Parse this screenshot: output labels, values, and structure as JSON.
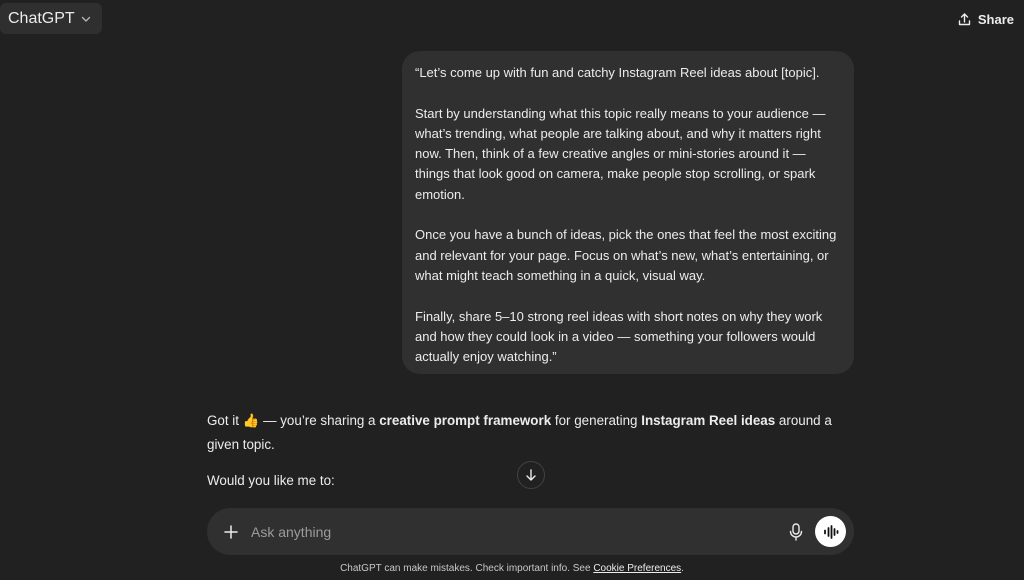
{
  "header": {
    "model_label": "ChatGPT",
    "share_label": "Share",
    "icons": {
      "model_dropdown": "chevron-down-icon",
      "share": "share-icon"
    }
  },
  "conversation": {
    "user_message": {
      "paragraphs": [
        "“Let’s come up with fun and catchy Instagram Reel ideas about [topic].",
        "Start by understanding what this topic really means to your audience — what’s trending, what people are talking about, and why it matters right now. Then, think of a few creative angles or mini-stories around it — things that look good on camera, make people stop scrolling, or spark emotion.",
        "Once you have a bunch of ideas, pick the ones that feel the most exciting and relevant for your page. Focus on what’s new, what’s entertaining, or what might teach something in a quick, visual way.",
        "Finally, share 5–10 strong reel ideas with short notes on why they work and how they could look in a video — something your followers would actually enjoy watching.”"
      ]
    },
    "assistant_message": {
      "intro_prefix": "Got it 👍 — you’re sharing a ",
      "intro_bold_1": "creative prompt framework",
      "intro_middle": " for generating ",
      "intro_bold_2": "Instagram Reel ideas",
      "intro_suffix": " around a given topic.",
      "question": "Would you like me to:"
    },
    "scroll_down_icon": "arrow-down-icon"
  },
  "composer": {
    "placeholder": "Ask anything",
    "value": "",
    "icons": {
      "attach": "plus-icon",
      "mic": "microphone-icon",
      "voice": "voice-mode-icon"
    }
  },
  "footer": {
    "disclaimer_prefix": "ChatGPT can make mistakes. Check important info. See ",
    "link_label": "Cookie Preferences",
    "disclaimer_suffix": "."
  },
  "colors": {
    "background": "#212121",
    "bubble": "#303030",
    "composer": "#303030",
    "text": "#ececec"
  }
}
